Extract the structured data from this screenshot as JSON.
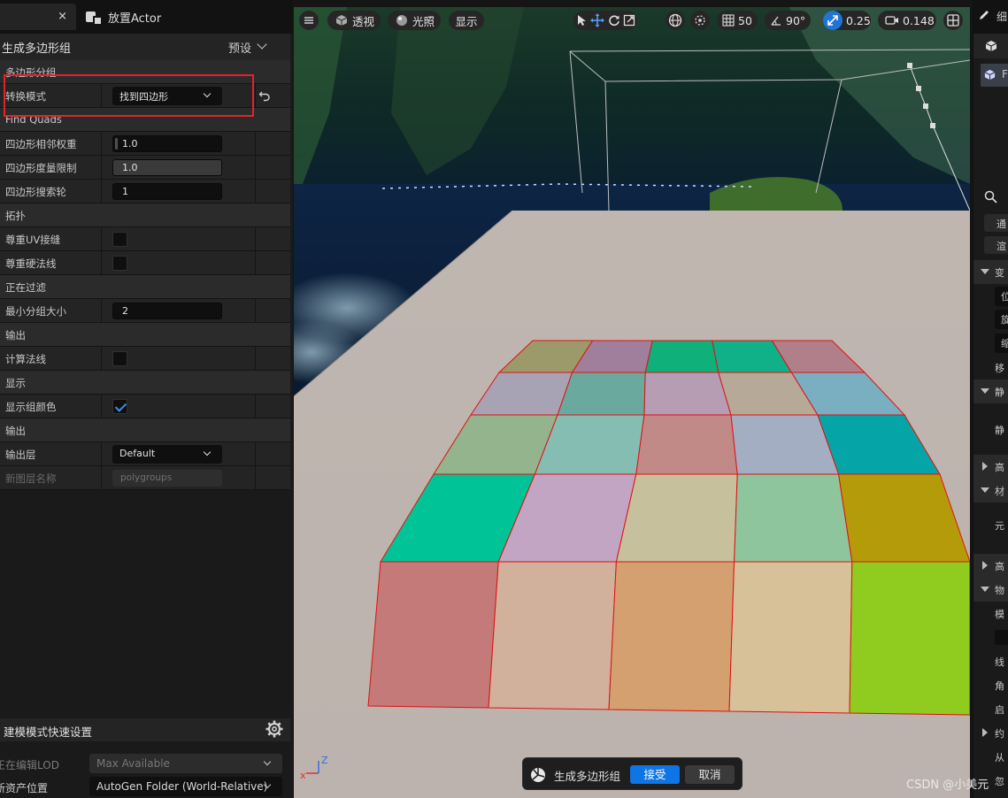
{
  "left_tabs": {
    "tab1_close": "×",
    "tab2_label": "放置Actor"
  },
  "panel_header": {
    "title": "生成多边形组",
    "preset_label": "预设"
  },
  "properties": [
    {
      "kind": "section",
      "label": "多边形分组"
    },
    {
      "kind": "dropdown",
      "label": "转换模式",
      "value": "找到四边形",
      "reset": true
    },
    {
      "kind": "section",
      "label": "Find Quads"
    },
    {
      "kind": "number",
      "label": "四边形相邻权重",
      "value": "1.0",
      "slider": true
    },
    {
      "kind": "number",
      "label": "四边形度量限制",
      "value": "1.0",
      "alt": true
    },
    {
      "kind": "number",
      "label": "四边形搜索轮",
      "value": "1"
    },
    {
      "kind": "section",
      "label": "拓扑"
    },
    {
      "kind": "check",
      "label": "尊重UV接缝",
      "checked": false
    },
    {
      "kind": "check",
      "label": "尊重硬法线",
      "checked": false
    },
    {
      "kind": "section",
      "label": "正在过滤"
    },
    {
      "kind": "number",
      "label": "最小分组大小",
      "value": "2"
    },
    {
      "kind": "section",
      "label": "输出"
    },
    {
      "kind": "check",
      "label": "计算法线",
      "checked": false
    },
    {
      "kind": "section",
      "label": "显示"
    },
    {
      "kind": "check",
      "label": "显示组颜色",
      "checked": true
    },
    {
      "kind": "section",
      "label": "输出"
    },
    {
      "kind": "dropdown",
      "label": "输出层",
      "value": "Default"
    },
    {
      "kind": "text",
      "label": "新图层名称",
      "value": "polygroups",
      "disabled": true
    }
  ],
  "quick_settings": {
    "title": "建模模式快速设置",
    "rows": [
      {
        "label": "正在编辑LOD",
        "value": "Max Available",
        "disabled": true
      },
      {
        "label": "新资产位置",
        "value": "AutoGen Folder (World-Relative)",
        "disabled": false
      }
    ]
  },
  "viewport_toolbar": {
    "perspective": "透视",
    "lighting": "光照",
    "show": "显示",
    "grid_value": "50",
    "rotation_value": "90°",
    "scale_value": "0.25",
    "camera_speed": "0.148"
  },
  "accept_bar": {
    "label": "生成多边形组",
    "accept": "接受",
    "cancel": "取消"
  },
  "axis_labels": {
    "z": "Z",
    "x": "x"
  },
  "right_panel": {
    "tab_label": "细",
    "item_letter": "F",
    "filters": [
      "通",
      "渲"
    ],
    "sections": [
      "变",
      "静",
      "高",
      "材",
      "高",
      "物"
    ],
    "labels": [
      "位",
      "旋",
      "缩",
      "移",
      "静",
      "元",
      "模",
      "线",
      "角",
      "启",
      "约",
      "从",
      "忽"
    ]
  },
  "watermark": "CSDN @小美元",
  "grid_colors": [
    [
      "#9c9a6a",
      "#a07f9d",
      "#10b07a",
      "#10b088",
      "#b07f8a"
    ],
    [
      "#a7a3b4",
      "#6aa99e",
      "#b69db3",
      "#b6a998",
      "#7aaec1"
    ],
    [
      "#93b48c",
      "#86bdb3",
      "#c28a86",
      "#a4aec2",
      "#05a4a7"
    ],
    [
      "#00c497",
      "#c2a5c2",
      "#c6c19c",
      "#8fc59c",
      "#b49b0a"
    ],
    [
      "#c47a78",
      "#d1b09c",
      "#d4a070",
      "#d6c199",
      "#8fcc1f"
    ]
  ]
}
